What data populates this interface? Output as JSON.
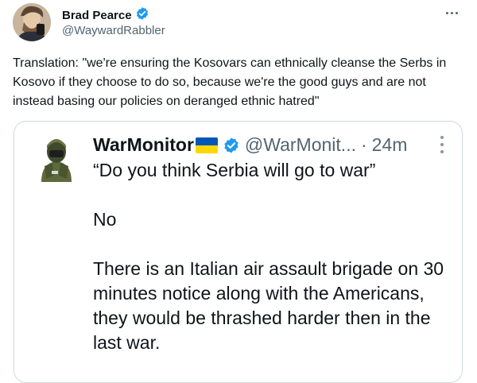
{
  "author": {
    "name": "Brad Pearce",
    "handle": "@WaywardRabbler",
    "verified": true
  },
  "tweet_text": "Translation: \"we're ensuring the Kosovars can ethnically cleanse the Serbs in Kosovo if they choose to do so, because we're the good guys and are not instead basing our policies on deranged ethnic hatred\"",
  "quoted": {
    "name": "WarMonitor",
    "flag": "ukraine-flag",
    "handle": "@WarMonit...",
    "separator": "·",
    "time": "24m",
    "line1": "“Do you think Serbia will go to war”",
    "line2": "No",
    "line3": "There is an Italian air assault brigade on 30 minutes notice along with the Americans, they would be thrashed harder then in the last war."
  },
  "icons": {
    "verified": "verified-badge-icon",
    "more": "more-options-icon"
  },
  "colors": {
    "verified": "#1d9bf0",
    "secondary_text": "#536471",
    "border": "#cfd9de",
    "flag_blue": "#0057b7",
    "flag_yellow": "#ffd700"
  }
}
